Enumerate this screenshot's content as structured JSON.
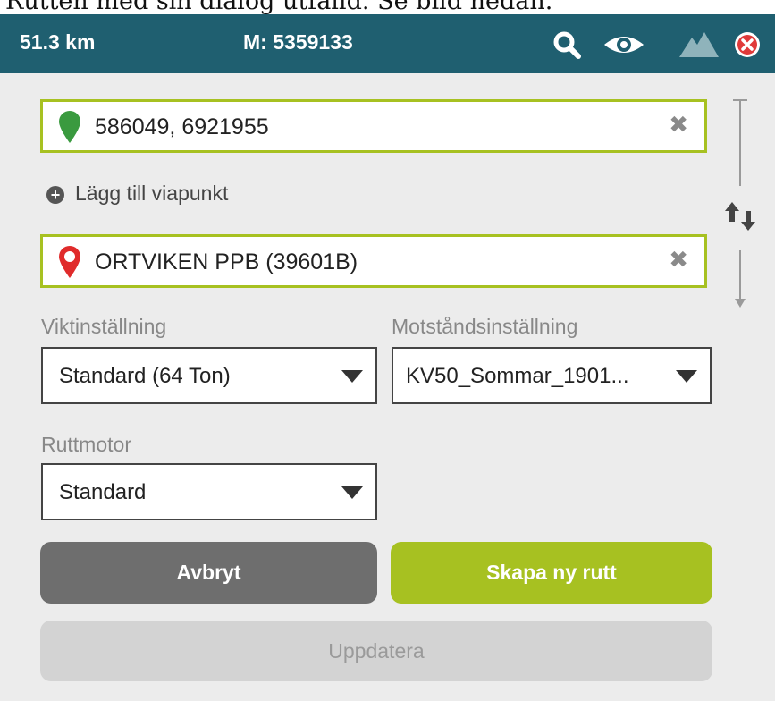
{
  "caption": "Rutten med sin dialog utfälld. Se bild nedan.",
  "topbar": {
    "distance": "51.3 km",
    "measure": "M: 5359133",
    "icons": [
      "search-icon",
      "eye-icon",
      "mountain-icon",
      "close-icon"
    ],
    "bg_color": "#1f5f70"
  },
  "route": {
    "start": {
      "value": "586049, 6921955",
      "pin_color": "#3a9a3f"
    },
    "add_waypoint_label": "Lägg till viapunkt",
    "end": {
      "value": "ORTVIKEN PPB (39601B)",
      "pin_color": "#e02b2b"
    },
    "clear_glyph": "✖"
  },
  "settings": {
    "weight_label": "Viktinställning",
    "weight_value": "Standard (64 Ton)",
    "resistance_label": "Motståndsinställning",
    "resistance_value": "KV50_Sommar_1901...",
    "engine_label": "Ruttmotor",
    "engine_value": "Standard"
  },
  "buttons": {
    "cancel": "Avbryt",
    "create": "Skapa ny rutt",
    "update": "Uppdatera"
  },
  "colors": {
    "accent": "#a7c121",
    "panel": "#ececec"
  }
}
